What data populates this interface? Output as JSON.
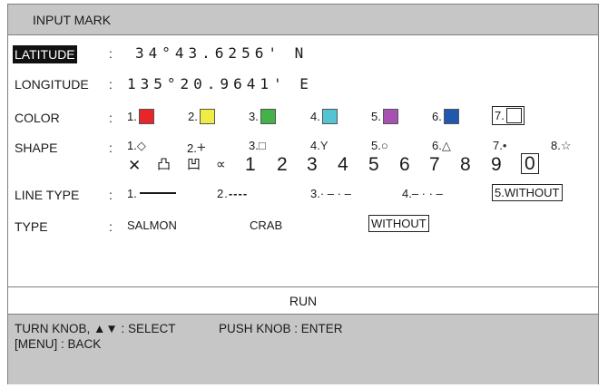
{
  "title": "INPUT MARK",
  "fields": {
    "latitude": {
      "label": "LATITUDE",
      "colon": ":",
      "value": "34°43.6256' N"
    },
    "longitude": {
      "label": "LONGITUDE",
      "colon": ":",
      "value": "135°20.9641' E"
    },
    "color": {
      "label": "COLOR",
      "colon": ":",
      "options": [
        {
          "num": "1.",
          "hex": "#e8262a"
        },
        {
          "num": "2.",
          "hex": "#eded45"
        },
        {
          "num": "3.",
          "hex": "#44b246"
        },
        {
          "num": "4.",
          "hex": "#54c4d2"
        },
        {
          "num": "5.",
          "hex": "#a751b0"
        },
        {
          "num": "6.",
          "hex": "#2058b0"
        },
        {
          "num": "7.",
          "hex": "#ffffff"
        }
      ]
    },
    "shape": {
      "label": "SHAPE",
      "colon": ":",
      "row1": [
        {
          "num": "1.",
          "glyph": "◇"
        },
        {
          "num": "2.",
          "glyph": "+"
        },
        {
          "num": "3.",
          "glyph": "□"
        },
        {
          "num": "4.",
          "glyph": "Y"
        },
        {
          "num": "5.",
          "glyph": "○"
        },
        {
          "num": "6.",
          "glyph": "△"
        },
        {
          "num": "7.",
          "glyph": "•"
        },
        {
          "num": "8.",
          "glyph": "☆"
        }
      ],
      "row2_symbols": [
        "✕",
        "凸",
        "凹",
        "∝"
      ],
      "row2_digits": [
        "1",
        "2",
        "3",
        "4",
        "5",
        "6",
        "7",
        "8",
        "9",
        "0"
      ]
    },
    "line_type": {
      "label": "LINE TYPE",
      "colon": ":",
      "options": [
        {
          "num": "1.",
          "pattern": "solid"
        },
        {
          "num": "2.",
          "pattern": "----"
        },
        {
          "num": "3.",
          "pattern": "· – · –"
        },
        {
          "num": "4.",
          "pattern": "– · · –"
        },
        {
          "num": "5.",
          "text": "5.WITHOUT"
        }
      ]
    },
    "type": {
      "label": "TYPE",
      "colon": ":",
      "options": [
        "SALMON",
        "CRAB",
        "WITHOUT"
      ]
    }
  },
  "run_label": "RUN",
  "footer": {
    "line1_left": "TURN KNOB, ▲▼ : SELECT",
    "line1_right": "PUSH KNOB : ENTER",
    "line2": "[MENU] : BACK"
  }
}
